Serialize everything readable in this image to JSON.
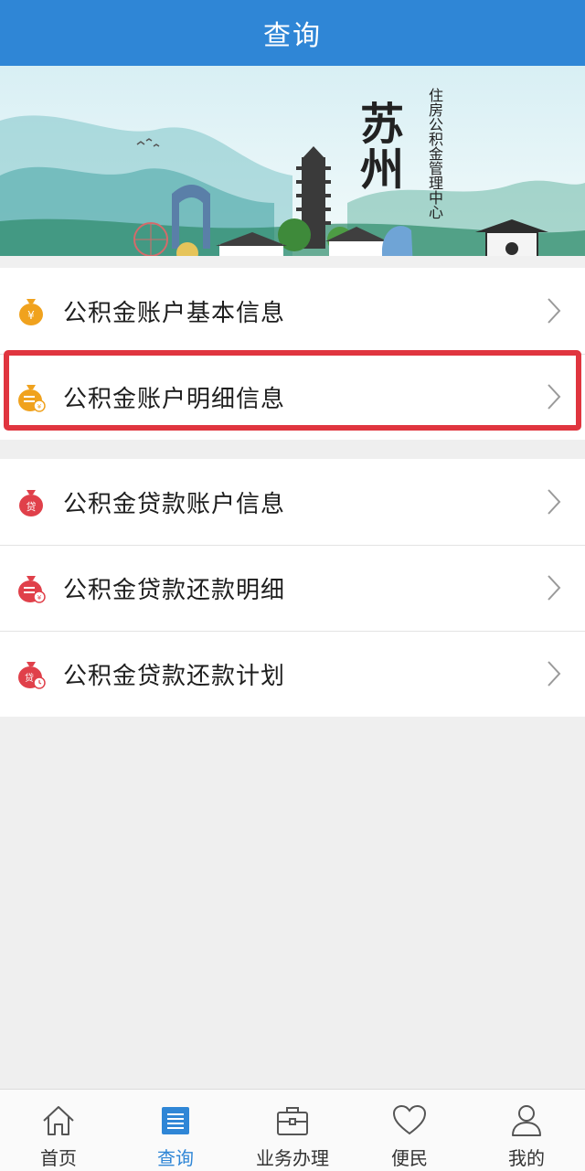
{
  "header": {
    "title": "查询"
  },
  "banner": {
    "city_calligraphy": "苏州",
    "org_name": "住房公积金管理中心"
  },
  "menu": {
    "group1": [
      {
        "label": "公积金账户基本信息",
        "icon": "yuan-moneybag-icon",
        "icon_color": "#f0a21e"
      },
      {
        "label": "公积金账户明细信息",
        "icon": "ledger-moneybag-icon",
        "icon_color": "#f0a21e"
      }
    ],
    "group2": [
      {
        "label": "公积金贷款账户信息",
        "icon": "loan-moneybag-icon",
        "icon_color": "#e0404a"
      },
      {
        "label": "公积金贷款还款明细",
        "icon": "repay-detail-icon",
        "icon_color": "#e0404a"
      },
      {
        "label": "公积金贷款还款计划",
        "icon": "repay-plan-icon",
        "icon_color": "#e0404a"
      }
    ]
  },
  "highlighted_item": "公积金账户明细信息",
  "tabbar": {
    "tabs": [
      {
        "label": "首页",
        "icon": "home-icon"
      },
      {
        "label": "查询",
        "icon": "query-icon",
        "active": true
      },
      {
        "label": "业务办理",
        "icon": "briefcase-icon"
      },
      {
        "label": "便民",
        "icon": "heart-icon"
      },
      {
        "label": "我的",
        "icon": "user-icon"
      }
    ]
  },
  "colors": {
    "primary": "#2f86d6",
    "highlight": "#e0353f",
    "orange": "#f0a21e",
    "red": "#e0404a"
  }
}
